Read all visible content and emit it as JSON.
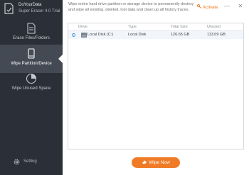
{
  "app": {
    "name": "DoYourData",
    "edition": "Super Eraser 4.0 Trial"
  },
  "sidebar": {
    "items": [
      {
        "label": "Erase Files/Folders",
        "icon": "document-icon",
        "active": false
      },
      {
        "label": "Wipe Partition/Device",
        "icon": "drive-icon",
        "active": true
      },
      {
        "label": "Wipe Unused Space",
        "icon": "pie-chart-icon",
        "active": false
      }
    ],
    "setting_label": "Setting"
  },
  "header": {
    "description": "Wipe entire hard drive partition or storage device to permanently destroy and wipe all existing, deleted, lost data and clean up all history traces.",
    "activate_label": "Activate",
    "minimize_glyph": "—",
    "close_glyph": "✕"
  },
  "table": {
    "columns": [
      "Drive",
      "Type",
      "Total Size",
      "Unused"
    ],
    "rows": [
      {
        "drive": "Local Disk (C:)",
        "type": "Local Disk",
        "total_size": "126.65 GB",
        "unused": "113.09 GB",
        "selected": true
      }
    ]
  },
  "actions": {
    "wipe_label": "Wipe Now"
  },
  "colors": {
    "sidebar_bg": "#2b3038",
    "sidebar_active": "#444a54",
    "accent": "#f07b26",
    "row_highlight": "#f2f6fb"
  }
}
